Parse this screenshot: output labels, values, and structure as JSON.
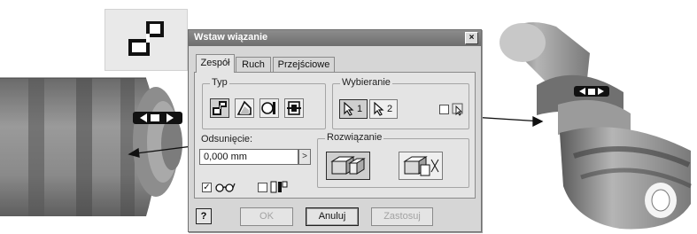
{
  "dialog": {
    "title": "Wstaw wiązanie",
    "close_glyph": "×",
    "tabs": [
      {
        "label": "Zespół",
        "active": true
      },
      {
        "label": "Ruch",
        "active": false
      },
      {
        "label": "Przejściowe",
        "active": false
      }
    ],
    "type_group": {
      "label": "Typ",
      "buttons": [
        {
          "icon": "mate-constraint-icon",
          "pressed": true
        },
        {
          "icon": "angle-constraint-icon",
          "pressed": false
        },
        {
          "icon": "tangent-constraint-icon",
          "pressed": false
        },
        {
          "icon": "insert-constraint-icon",
          "pressed": false
        }
      ]
    },
    "selection_group": {
      "label": "Wybieranie",
      "first_pick": "1",
      "second_pick": "2",
      "first_selected": true
    },
    "offset": {
      "label": "Odsunięcie:",
      "value": "0,000 mm",
      "spin_glyph": ">"
    },
    "solution_group": {
      "label": "Rozwiązanie",
      "options": [
        {
          "icon": "opposed-solution-icon",
          "pressed": true
        },
        {
          "icon": "aligned-solution-icon",
          "pressed": false
        }
      ]
    },
    "options": {
      "show_preview_checked": true,
      "show_preview_icon": "glasses-icon",
      "predict_offset_checked": false,
      "predict_offset_icon": "predict-offset-icon",
      "check_glyph": "✓"
    },
    "buttons": {
      "help": "?",
      "ok": "OK",
      "cancel": "Anuluj",
      "apply": "Zastosuj"
    }
  },
  "icons": {
    "large_icon": "mate-constraint-icon",
    "left_part_glyph": "mate-glyph-icon",
    "right_part_glyph": "mate-glyph-icon"
  },
  "colors": {
    "title_bar": "#7c7c7c",
    "dialog_face": "#d6d6d6",
    "disabled_text": "#a2a2a2"
  }
}
